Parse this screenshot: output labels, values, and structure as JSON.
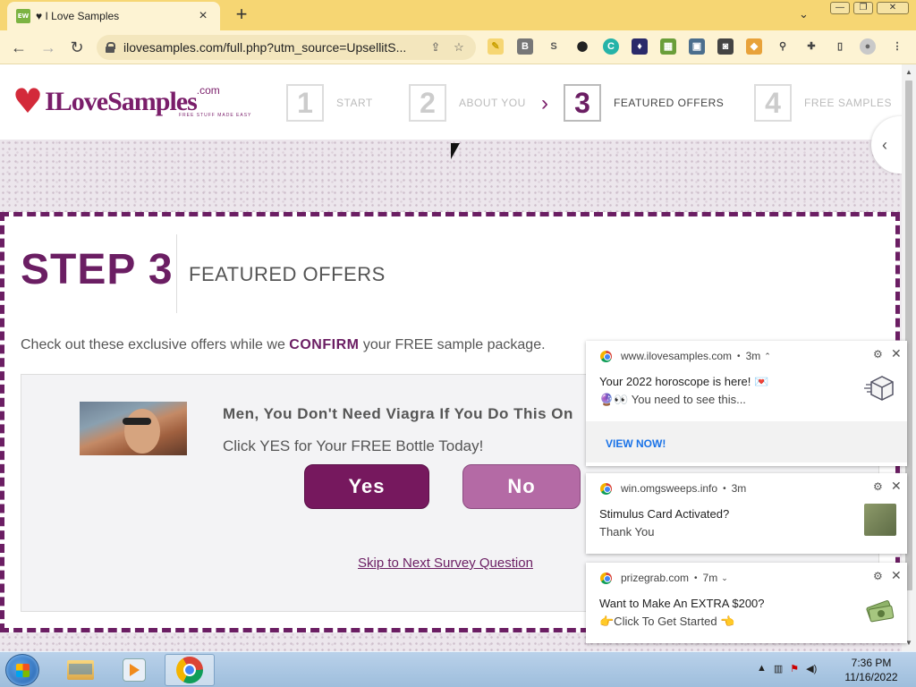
{
  "browser": {
    "tab": {
      "favicon": "EW",
      "title": "♥ I Love Samples",
      "close": "×"
    },
    "new_tab": "+",
    "url": "ilovesamples.com/full.php?utm_source=UpsellitS...",
    "window_controls": [
      "—",
      "❐",
      "✕"
    ]
  },
  "site": {
    "logo": {
      "text": "ILoveSamples",
      "suffix": ".com",
      "tagline": "FREE STUFF MADE EASY"
    },
    "steps": [
      {
        "num": "1",
        "label": "START"
      },
      {
        "num": "2",
        "label": "ABOUT YOU"
      },
      {
        "num": "3",
        "label": "FEATURED OFFERS"
      },
      {
        "num": "4",
        "label": "FREE SAMPLES"
      }
    ],
    "active_step": 3
  },
  "content": {
    "step_heading": "STEP 3",
    "section_title": "FEATURED OFFERS",
    "intro_before": "Check out these exclusive offers while we ",
    "intro_highlight": "CONFIRM",
    "intro_after": " your FREE sample package.",
    "offer": {
      "headline": "Men, You Don't Need Viagra If You Do This On",
      "subtext": "Click YES for Your FREE Bottle Today!",
      "yes_label": "Yes",
      "no_label": "No",
      "skip_label": "Skip to Next Survey Question"
    }
  },
  "notifications": [
    {
      "site": "www.ilovesamples.com",
      "time": "3m",
      "title": "Your 2022 horoscope is here! 💌",
      "body": "🔮👀 You need to see this...",
      "action": "VIEW NOW!"
    },
    {
      "site": "win.omgsweeps.info",
      "time": "3m",
      "title": "Stimulus Card Activated?",
      "body": "Thank You"
    },
    {
      "site": "prizegrab.com",
      "time": "7m",
      "title": "Want to Make An EXTRA $200?",
      "body": "👉Click To Get Started 👈"
    }
  ],
  "taskbar": {
    "time": "7:36 PM",
    "date": "11/16/2022"
  },
  "colors": {
    "brand": "#6b1e63",
    "tabbar": "#f6d673",
    "toolbar": "#fdf3d3"
  }
}
